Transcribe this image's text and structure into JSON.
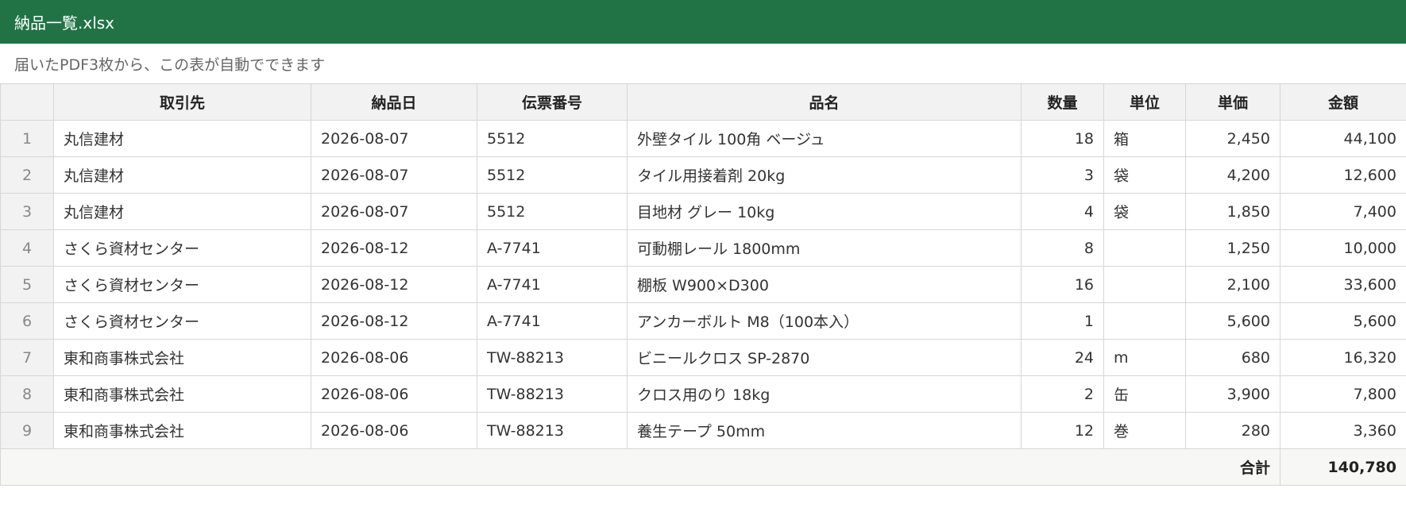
{
  "window": {
    "title": "納品一覧.xlsx"
  },
  "note": "届いたPDF3枚から、この表が自動でできます",
  "table": {
    "headers": [
      "取引先",
      "納品日",
      "伝票番号",
      "品名",
      "数量",
      "単位",
      "単価",
      "金額"
    ],
    "rows": [
      {
        "n": "1",
        "vendor": "丸信建材",
        "date": "2026-08-07",
        "slip": "5512",
        "item": "外壁タイル 100角 ベージュ",
        "qty": "18",
        "unit": "箱",
        "price": "2,450",
        "amount": "44,100"
      },
      {
        "n": "2",
        "vendor": "丸信建材",
        "date": "2026-08-07",
        "slip": "5512",
        "item": "タイル用接着剤 20kg",
        "qty": "3",
        "unit": "袋",
        "price": "4,200",
        "amount": "12,600"
      },
      {
        "n": "3",
        "vendor": "丸信建材",
        "date": "2026-08-07",
        "slip": "5512",
        "item": "目地材 グレー 10kg",
        "qty": "4",
        "unit": "袋",
        "price": "1,850",
        "amount": "7,400"
      },
      {
        "n": "4",
        "vendor": "さくら資材センター",
        "date": "2026-08-12",
        "slip": "A-7741",
        "item": "可動棚レール 1800mm",
        "qty": "8",
        "unit": "",
        "price": "1,250",
        "amount": "10,000"
      },
      {
        "n": "5",
        "vendor": "さくら資材センター",
        "date": "2026-08-12",
        "slip": "A-7741",
        "item": "棚板 W900×D300",
        "qty": "16",
        "unit": "",
        "price": "2,100",
        "amount": "33,600"
      },
      {
        "n": "6",
        "vendor": "さくら資材センター",
        "date": "2026-08-12",
        "slip": "A-7741",
        "item": "アンカーボルト M8（100本入）",
        "qty": "1",
        "unit": "",
        "price": "5,600",
        "amount": "5,600"
      },
      {
        "n": "7",
        "vendor": "東和商事株式会社",
        "date": "2026-08-06",
        "slip": "TW-88213",
        "item": "ビニールクロス SP-2870",
        "qty": "24",
        "unit": "m",
        "price": "680",
        "amount": "16,320"
      },
      {
        "n": "8",
        "vendor": "東和商事株式会社",
        "date": "2026-08-06",
        "slip": "TW-88213",
        "item": "クロス用のり 18kg",
        "qty": "2",
        "unit": "缶",
        "price": "3,900",
        "amount": "7,800"
      },
      {
        "n": "9",
        "vendor": "東和商事株式会社",
        "date": "2026-08-06",
        "slip": "TW-88213",
        "item": "養生テープ 50mm",
        "qty": "12",
        "unit": "巻",
        "price": "280",
        "amount": "3,360"
      }
    ],
    "total_label": "合計",
    "total_value": "140,780"
  }
}
